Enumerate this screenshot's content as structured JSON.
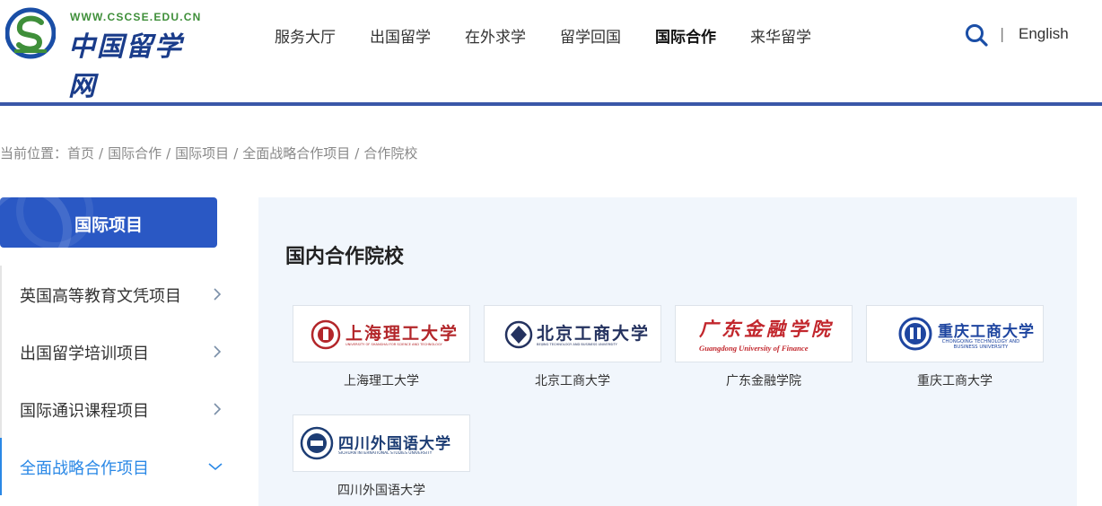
{
  "header": {
    "logo_url_text": "WWW.CSCSE.EDU.CN",
    "logo_cn_text": "中国留学网",
    "nav": [
      "服务大厅",
      "出国留学",
      "在外求学",
      "留学回国",
      "国际合作",
      "来华留学"
    ],
    "active_nav": "国际合作",
    "separator": "|",
    "language_link": "English"
  },
  "breadcrumb": {
    "prefix": "当前位置：",
    "items": [
      "首页",
      "国际合作",
      "国际项目",
      "全面战略合作项目",
      "合作院校"
    ],
    "separator": "/"
  },
  "sidebar": {
    "title": "国际项目",
    "items": [
      {
        "label": "英国高等教育文凭项目",
        "state": "collapsed"
      },
      {
        "label": "出国留学培训项目",
        "state": "collapsed"
      },
      {
        "label": "国际通识课程项目",
        "state": "collapsed"
      },
      {
        "label": "全面战略合作项目",
        "state": "expanded"
      }
    ]
  },
  "main": {
    "title": "国内合作院校",
    "schools": [
      {
        "name": "上海理工大学",
        "logo_cn": "上海理工大学",
        "logo_en": "UNIVERSITY OF SHANGHAI FOR SCIENCE AND TECHNOLOGY",
        "logo_color": "#b3262a"
      },
      {
        "name": "北京工商大学",
        "logo_cn": "北京工商大学",
        "logo_en": "BEIJING TECHNOLOGY AND BUSINESS UNIVERSITY",
        "logo_color": "#24325f"
      },
      {
        "name": "广东金融学院",
        "logo_cn": "广东金融学院",
        "logo_en": "Guangdong University of Finance",
        "logo_color": "#c2272d"
      },
      {
        "name": "重庆工商大学",
        "logo_cn": "重庆工商大学",
        "logo_en": "CHONGQING TECHNOLOGY AND BUSINESS UNIVERSITY",
        "logo_color": "#1f46a0"
      },
      {
        "name": "四川外国语大学",
        "logo_cn": "四川外国语大学",
        "logo_en": "SICHUAN INTERNATIONAL STUDIES UNIVERSITY",
        "logo_color": "#1d3d74"
      }
    ]
  },
  "colors": {
    "brand_blue": "#2a58c4",
    "header_rule": "#3a57a8",
    "active_side": "#2a88e6",
    "panel_bg": "#f1f6fc"
  },
  "icons": {
    "search": "search-icon",
    "chevron_right": "chevron-right-icon",
    "chevron_down": "chevron-down-icon"
  }
}
